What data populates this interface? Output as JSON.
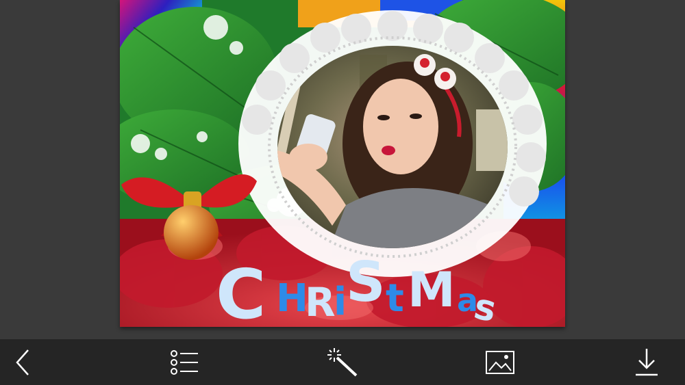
{
  "canvas": {
    "frame_title": "CHRiStMas",
    "frame_letters": [
      "C",
      "H",
      "R",
      "i",
      "S",
      "t",
      "M",
      "a",
      "s"
    ]
  },
  "toolbar": {
    "items": [
      {
        "id": "back",
        "icon": "chevron-left-icon"
      },
      {
        "id": "frames",
        "icon": "list-icon"
      },
      {
        "id": "effects",
        "icon": "magic-wand-icon"
      },
      {
        "id": "gallery",
        "icon": "image-icon"
      },
      {
        "id": "save",
        "icon": "download-icon"
      }
    ]
  },
  "colors": {
    "background": "#3b3b3b",
    "toolbar": "#252525",
    "icon": "#ffffff",
    "title_light": "#cfe6fb",
    "title_blue": "#2d8be8"
  }
}
